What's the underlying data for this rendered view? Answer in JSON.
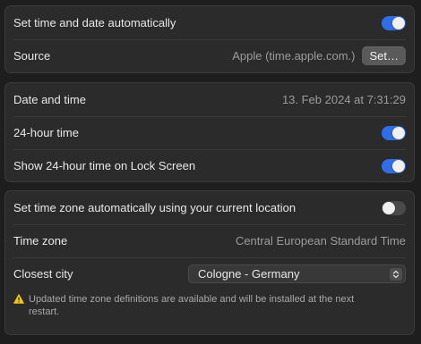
{
  "group1": {
    "auto_time_label": "Set time and date automatically",
    "auto_time_on": true,
    "source_label": "Source",
    "source_value": "Apple (time.apple.com.)",
    "set_button_label": "Set…"
  },
  "group2": {
    "datetime_label": "Date and time",
    "datetime_value": "13. Feb 2024 at 7:31:29",
    "hour24_label": "24-hour time",
    "hour24_on": true,
    "lock_screen_label": "Show 24-hour time on Lock Screen",
    "lock_screen_on": true
  },
  "group3": {
    "auto_tz_label": "Set time zone automatically using your current location",
    "auto_tz_on": false,
    "timezone_label": "Time zone",
    "timezone_value": "Central European Standard Time",
    "city_label": "Closest city",
    "city_value": "Cologne - Germany",
    "note_text": "Updated time zone definitions are available and will be installed at the next restart."
  },
  "colors": {
    "accent": "#2f6ee6",
    "warning": "#f5c518"
  },
  "icons": {
    "warning": "warning-icon",
    "chevron": "chevron-updown-icon"
  }
}
